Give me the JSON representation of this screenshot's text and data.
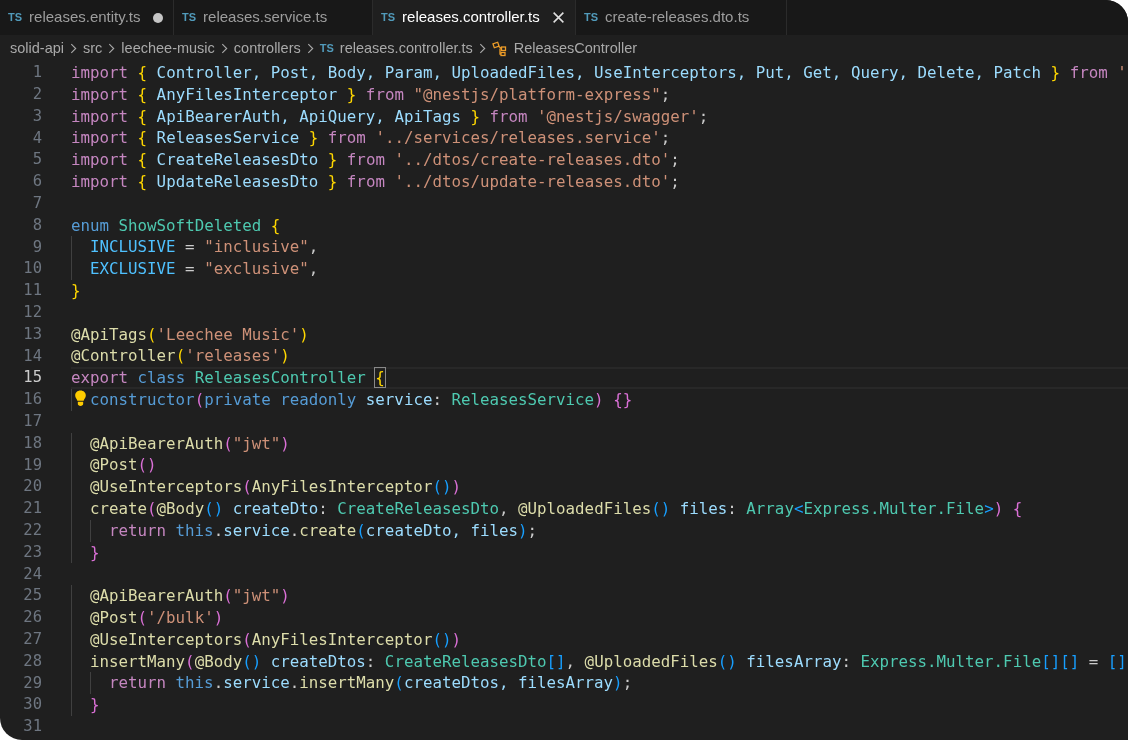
{
  "tabs": [
    {
      "lang": "TS",
      "label": "releases.entity.ts",
      "selected": false,
      "modified": true
    },
    {
      "lang": "TS",
      "label": "releases.service.ts",
      "selected": false,
      "modified": false
    },
    {
      "lang": "TS",
      "label": "releases.controller.ts",
      "selected": true,
      "modified": false
    },
    {
      "lang": "TS",
      "label": "create-releases.dto.ts",
      "selected": false,
      "modified": false
    }
  ],
  "breadcrumb": [
    {
      "kind": "folder",
      "label": "solid-api"
    },
    {
      "kind": "folder",
      "label": "src"
    },
    {
      "kind": "folder",
      "label": "leechee-music"
    },
    {
      "kind": "folder",
      "label": "controllers"
    },
    {
      "kind": "file",
      "lang": "TS",
      "label": "releases.controller.ts"
    },
    {
      "kind": "class",
      "label": "ReleasesController"
    }
  ],
  "lines": [
    {
      "number": "1",
      "active": false,
      "lightbulb": false,
      "tokens": [
        {
          "text": "import",
          "kind": "keyword"
        },
        {
          "text": " {",
          "kind": "bracket1"
        },
        {
          "text": " Controller, Post, Body, Param, UploadedFiles, UseInterceptors, Put, Get, Query, Delete, Patch",
          "kind": "variable"
        },
        {
          "text": " }",
          "kind": "bracket1"
        },
        {
          "text": " from",
          "kind": "keyword"
        },
        {
          "text": " '",
          "kind": "string"
        }
      ]
    },
    {
      "number": "2",
      "active": false,
      "lightbulb": false,
      "tokens": [
        {
          "text": "import",
          "kind": "keyword"
        },
        {
          "text": " {",
          "kind": "bracket1"
        },
        {
          "text": " AnyFilesInterceptor",
          "kind": "variable"
        },
        {
          "text": " }",
          "kind": "bracket1"
        },
        {
          "text": " from",
          "kind": "keyword"
        },
        {
          "text": " \"@nestjs/platform-express\"",
          "kind": "string"
        },
        {
          "text": ";",
          "kind": "plain"
        }
      ]
    },
    {
      "number": "3",
      "active": false,
      "lightbulb": false,
      "tokens": [
        {
          "text": "import",
          "kind": "keyword"
        },
        {
          "text": " {",
          "kind": "bracket1"
        },
        {
          "text": " ApiBearerAuth, ApiQuery, ApiTags",
          "kind": "variable"
        },
        {
          "text": " }",
          "kind": "bracket1"
        },
        {
          "text": " from",
          "kind": "keyword"
        },
        {
          "text": " '@nestjs/swagger'",
          "kind": "string"
        },
        {
          "text": ";",
          "kind": "plain"
        }
      ]
    },
    {
      "number": "4",
      "active": false,
      "lightbulb": false,
      "tokens": [
        {
          "text": "import",
          "kind": "keyword"
        },
        {
          "text": " {",
          "kind": "bracket1"
        },
        {
          "text": " ReleasesService",
          "kind": "variable"
        },
        {
          "text": " }",
          "kind": "bracket1"
        },
        {
          "text": " from",
          "kind": "keyword"
        },
        {
          "text": " '../services/releases.service'",
          "kind": "string"
        },
        {
          "text": ";",
          "kind": "plain"
        }
      ]
    },
    {
      "number": "5",
      "active": false,
      "lightbulb": false,
      "tokens": [
        {
          "text": "import",
          "kind": "keyword"
        },
        {
          "text": " {",
          "kind": "bracket1"
        },
        {
          "text": " CreateReleasesDto",
          "kind": "variable"
        },
        {
          "text": " }",
          "kind": "bracket1"
        },
        {
          "text": " from",
          "kind": "keyword"
        },
        {
          "text": " '../dtos/create-releases.dto'",
          "kind": "string"
        },
        {
          "text": ";",
          "kind": "plain"
        }
      ]
    },
    {
      "number": "6",
      "active": false,
      "lightbulb": false,
      "tokens": [
        {
          "text": "import",
          "kind": "keyword"
        },
        {
          "text": " {",
          "kind": "bracket1"
        },
        {
          "text": " UpdateReleasesDto",
          "kind": "variable"
        },
        {
          "text": " }",
          "kind": "bracket1"
        },
        {
          "text": " from",
          "kind": "keyword"
        },
        {
          "text": " '../dtos/update-releases.dto'",
          "kind": "string"
        },
        {
          "text": ";",
          "kind": "plain"
        }
      ]
    },
    {
      "number": "7",
      "active": false,
      "lightbulb": false
    },
    {
      "number": "8",
      "active": false,
      "lightbulb": false,
      "tokens": [
        {
          "text": "enum",
          "kind": "storage"
        },
        {
          "text": " ShowSoftDeleted",
          "kind": "type"
        },
        {
          "text": " {",
          "kind": "bracket1"
        }
      ]
    },
    {
      "number": "9",
      "active": false,
      "lightbulb": false,
      "tokens": [
        {
          "text": "  INCLUSIVE",
          "kind": "member"
        },
        {
          "text": " =",
          "kind": "plain"
        },
        {
          "text": " \"inclusive\"",
          "kind": "string"
        },
        {
          "text": ",",
          "kind": "plain"
        }
      ]
    },
    {
      "number": "10",
      "active": false,
      "lightbulb": false,
      "tokens": [
        {
          "text": "  EXCLUSIVE",
          "kind": "member"
        },
        {
          "text": " =",
          "kind": "plain"
        },
        {
          "text": " \"exclusive\"",
          "kind": "string"
        },
        {
          "text": ",",
          "kind": "plain"
        }
      ]
    },
    {
      "number": "11",
      "active": false,
      "lightbulb": false,
      "tokens": [
        {
          "text": "}",
          "kind": "bracket1"
        }
      ]
    },
    {
      "number": "12",
      "active": false,
      "lightbulb": false
    },
    {
      "number": "13",
      "active": false,
      "lightbulb": false,
      "tokens": [
        {
          "text": "@ApiTags",
          "kind": "function"
        },
        {
          "text": "(",
          "kind": "bracket1"
        },
        {
          "text": "'Leechee Music'",
          "kind": "string"
        },
        {
          "text": ")",
          "kind": "bracket1"
        }
      ]
    },
    {
      "number": "14",
      "active": false,
      "lightbulb": false,
      "tokens": [
        {
          "text": "@Controller",
          "kind": "function"
        },
        {
          "text": "(",
          "kind": "bracket1"
        },
        {
          "text": "'releases'",
          "kind": "string"
        },
        {
          "text": ")",
          "kind": "bracket1"
        }
      ]
    },
    {
      "number": "15",
      "active": true,
      "lightbulb": false,
      "tokens": [
        {
          "text": "export",
          "kind": "keyword"
        },
        {
          "text": " class",
          "kind": "storage"
        },
        {
          "text": " ReleasesController",
          "kind": "type"
        },
        {
          "text": "{",
          "kind": "matched-bracket"
        }
      ]
    },
    {
      "number": "16",
      "active": false,
      "lightbulb": true,
      "tokens": [
        {
          "text": "  constructor",
          "kind": "storage"
        },
        {
          "text": "(",
          "kind": "bracket2"
        },
        {
          "text": "private",
          "kind": "storage"
        },
        {
          "text": " readonly",
          "kind": "storage"
        },
        {
          "text": " service",
          "kind": "variable"
        },
        {
          "text": ":",
          "kind": "plain"
        },
        {
          "text": " ReleasesService",
          "kind": "type"
        },
        {
          "text": ")",
          "kind": "bracket2"
        },
        {
          "text": " {}",
          "kind": "bracket2"
        }
      ]
    },
    {
      "number": "17",
      "active": false,
      "lightbulb": false
    },
    {
      "number": "18",
      "active": false,
      "lightbulb": false,
      "tokens": [
        {
          "text": "  @ApiBearerAuth",
          "kind": "function"
        },
        {
          "text": "(",
          "kind": "bracket2"
        },
        {
          "text": "\"jwt\"",
          "kind": "string"
        },
        {
          "text": ")",
          "kind": "bracket2"
        }
      ]
    },
    {
      "number": "19",
      "active": false,
      "lightbulb": false,
      "tokens": [
        {
          "text": "  @Post",
          "kind": "function"
        },
        {
          "text": "()",
          "kind": "bracket2"
        }
      ]
    },
    {
      "number": "20",
      "active": false,
      "lightbulb": false,
      "tokens": [
        {
          "text": "  @UseInterceptors",
          "kind": "function"
        },
        {
          "text": "(",
          "kind": "bracket2"
        },
        {
          "text": "AnyFilesInterceptor",
          "kind": "function"
        },
        {
          "text": "()",
          "kind": "bracket3"
        },
        {
          "text": ")",
          "kind": "bracket2"
        }
      ]
    },
    {
      "number": "21",
      "active": false,
      "lightbulb": false,
      "tokens": [
        {
          "text": "  create",
          "kind": "function"
        },
        {
          "text": "(",
          "kind": "bracket2"
        },
        {
          "text": "@Body",
          "kind": "function"
        },
        {
          "text": "()",
          "kind": "bracket3"
        },
        {
          "text": " createDto",
          "kind": "variable"
        },
        {
          "text": ":",
          "kind": "plain"
        },
        {
          "text": " CreateReleasesDto",
          "kind": "type"
        },
        {
          "text": ",",
          "kind": "plain"
        },
        {
          "text": " @UploadedFiles",
          "kind": "function"
        },
        {
          "text": "()",
          "kind": "bracket3"
        },
        {
          "text": " files",
          "kind": "variable"
        },
        {
          "text": ":",
          "kind": "plain"
        },
        {
          "text": " Array",
          "kind": "type"
        },
        {
          "text": "<",
          "kind": "bracket3"
        },
        {
          "text": "Express.Multer.File",
          "kind": "type"
        },
        {
          "text": ">",
          "kind": "bracket3"
        },
        {
          "text": ")",
          "kind": "bracket2"
        },
        {
          "text": " {",
          "kind": "bracket2"
        }
      ]
    },
    {
      "number": "22",
      "active": false,
      "lightbulb": false,
      "tokens": [
        {
          "text": "    return",
          "kind": "keyword"
        },
        {
          "text": " this",
          "kind": "storage"
        },
        {
          "text": ".",
          "kind": "plain"
        },
        {
          "text": "service",
          "kind": "variable"
        },
        {
          "text": ".",
          "kind": "plain"
        },
        {
          "text": "create",
          "kind": "function"
        },
        {
          "text": "(",
          "kind": "bracket3"
        },
        {
          "text": "createDto, files",
          "kind": "variable"
        },
        {
          "text": ")",
          "kind": "bracket3"
        },
        {
          "text": ";",
          "kind": "plain"
        }
      ]
    },
    {
      "number": "23",
      "active": false,
      "lightbulb": false,
      "tokens": [
        {
          "text": "  }",
          "kind": "bracket2"
        }
      ]
    },
    {
      "number": "24",
      "active": false,
      "lightbulb": false
    },
    {
      "number": "25",
      "active": false,
      "lightbulb": false,
      "tokens": [
        {
          "text": "  @ApiBearerAuth",
          "kind": "function"
        },
        {
          "text": "(",
          "kind": "bracket2"
        },
        {
          "text": "\"jwt\"",
          "kind": "string"
        },
        {
          "text": ")",
          "kind": "bracket2"
        }
      ]
    },
    {
      "number": "26",
      "active": false,
      "lightbulb": false,
      "tokens": [
        {
          "text": "  @Post",
          "kind": "function"
        },
        {
          "text": "(",
          "kind": "bracket2"
        },
        {
          "text": "'/bulk'",
          "kind": "string"
        },
        {
          "text": ")",
          "kind": "bracket2"
        }
      ]
    },
    {
      "number": "27",
      "active": false,
      "lightbulb": false,
      "tokens": [
        {
          "text": "  @UseInterceptors",
          "kind": "function"
        },
        {
          "text": "(",
          "kind": "bracket2"
        },
        {
          "text": "AnyFilesInterceptor",
          "kind": "function"
        },
        {
          "text": "()",
          "kind": "bracket3"
        },
        {
          "text": ")",
          "kind": "bracket2"
        }
      ]
    },
    {
      "number": "28",
      "active": false,
      "lightbulb": false,
      "tokens": [
        {
          "text": "  insertMany",
          "kind": "function"
        },
        {
          "text": "(",
          "kind": "bracket2"
        },
        {
          "text": "@Body",
          "kind": "function"
        },
        {
          "text": "()",
          "kind": "bracket3"
        },
        {
          "text": " createDtos",
          "kind": "variable"
        },
        {
          "text": ":",
          "kind": "plain"
        },
        {
          "text": " CreateReleasesDto",
          "kind": "type"
        },
        {
          "text": "[]",
          "kind": "bracket3"
        },
        {
          "text": ",",
          "kind": "plain"
        },
        {
          "text": " @UploadedFiles",
          "kind": "function"
        },
        {
          "text": "()",
          "kind": "bracket3"
        },
        {
          "text": " filesArray",
          "kind": "variable"
        },
        {
          "text": ":",
          "kind": "plain"
        },
        {
          "text": " Express.Multer.File",
          "kind": "type"
        },
        {
          "text": "[][]",
          "kind": "bracket3"
        },
        {
          "text": " =",
          "kind": "plain"
        },
        {
          "text": " []",
          "kind": "bracket3"
        }
      ]
    },
    {
      "number": "29",
      "active": false,
      "lightbulb": false,
      "tokens": [
        {
          "text": "    return",
          "kind": "keyword"
        },
        {
          "text": " this",
          "kind": "storage"
        },
        {
          "text": ".",
          "kind": "plain"
        },
        {
          "text": "service",
          "kind": "variable"
        },
        {
          "text": ".",
          "kind": "plain"
        },
        {
          "text": "insertMany",
          "kind": "function"
        },
        {
          "text": "(",
          "kind": "bracket3"
        },
        {
          "text": "createDtos, filesArray",
          "kind": "variable"
        },
        {
          "text": ")",
          "kind": "bracket3"
        },
        {
          "text": ";",
          "kind": "plain"
        }
      ]
    },
    {
      "number": "30",
      "active": false,
      "lightbulb": false,
      "tokens": [
        {
          "text": "  }",
          "kind": "bracket2"
        }
      ]
    },
    {
      "number": "31",
      "active": false,
      "lightbulb": false
    }
  ]
}
